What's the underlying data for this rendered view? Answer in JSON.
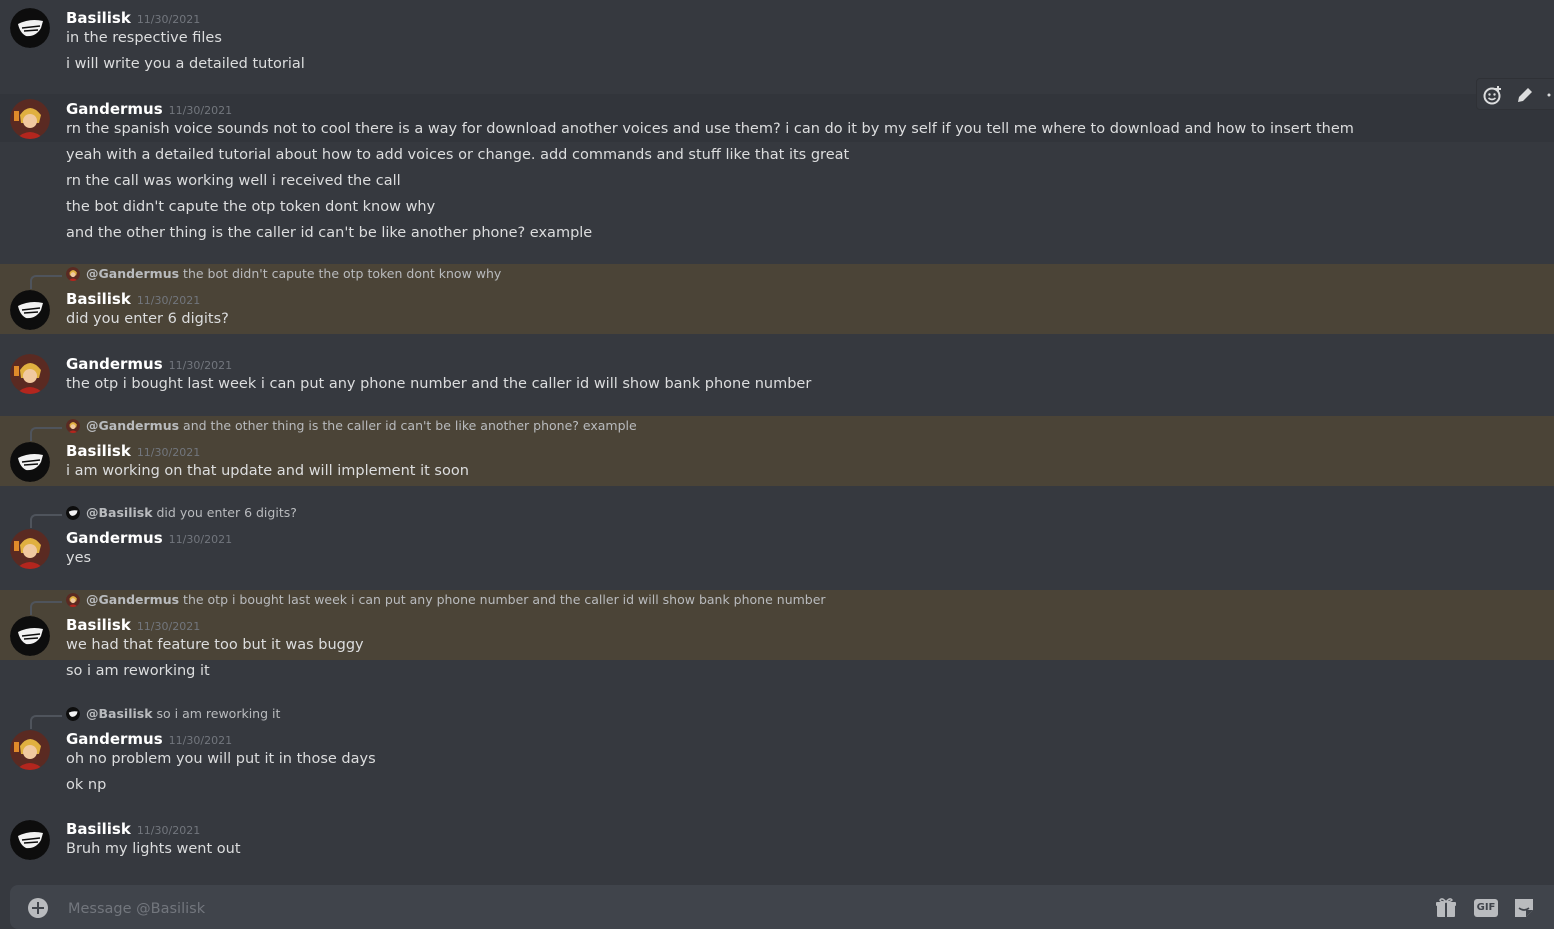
{
  "users": {
    "basilisk": {
      "name": "Basilisk"
    },
    "gandermus": {
      "name": "Gandermus"
    }
  },
  "messages": [
    {
      "author": "Basilisk",
      "timestamp": "11/30/2021",
      "lines": [
        "in the respective files",
        "i will write you a detailed tutorial"
      ]
    },
    {
      "author": "Gandermus",
      "timestamp": "11/30/2021",
      "lines": [
        "rn the spanish voice sounds not to cool there is a way for download another voices and use them? i can do it by my self if you tell me where to download and how to insert them",
        "yeah with a detailed tutorial about how to add voices or change. add commands and stuff like that its great",
        "rn the call was working well i received the call",
        "the bot didn't capute the otp token dont know why",
        "and the other thing is the caller id can't be like another phone? example"
      ]
    },
    {
      "author": "Basilisk",
      "timestamp": "11/30/2021",
      "reply": {
        "mention": "@Gandermus",
        "text": "the bot didn't capute the otp token dont know why"
      },
      "lines": [
        "did you enter 6 digits?"
      ]
    },
    {
      "author": "Gandermus",
      "timestamp": "11/30/2021",
      "lines": [
        "the otp i bought last week i can put any phone number and the caller id will show bank phone number"
      ]
    },
    {
      "author": "Basilisk",
      "timestamp": "11/30/2021",
      "reply": {
        "mention": "@Gandermus",
        "text": "and the other thing is the caller id can't be like another phone? example"
      },
      "lines": [
        "i am working on that update and will implement it soon"
      ]
    },
    {
      "author": "Gandermus",
      "timestamp": "11/30/2021",
      "reply": {
        "mention": "@Basilisk",
        "text": "did you enter 6 digits?"
      },
      "lines": [
        "yes"
      ]
    },
    {
      "author": "Basilisk",
      "timestamp": "11/30/2021",
      "reply": {
        "mention": "@Gandermus",
        "text": "the otp i bought last week i can put any phone number and the caller id will show bank phone number"
      },
      "lines": [
        "we had that feature too but it was buggy",
        "so i am reworking it"
      ]
    },
    {
      "author": "Gandermus",
      "timestamp": "11/30/2021",
      "reply": {
        "mention": "@Basilisk",
        "text": "so i am reworking it"
      },
      "lines": [
        "oh no problem you will put it in those days",
        "ok np"
      ]
    },
    {
      "author": "Basilisk",
      "timestamp": "11/30/2021",
      "lines": [
        "Bruh my lights went out"
      ]
    }
  ],
  "composer": {
    "placeholder": "Message @Basilisk",
    "gif_label": "GIF"
  },
  "colors": {
    "background": "#36393f",
    "mention_highlight": "#4b4437",
    "composer": "#40444b"
  },
  "icons": [
    "add-reaction-icon",
    "edit-icon",
    "more-icon",
    "add-attachment-icon",
    "gift-icon",
    "gif-icon",
    "sticker-icon"
  ]
}
